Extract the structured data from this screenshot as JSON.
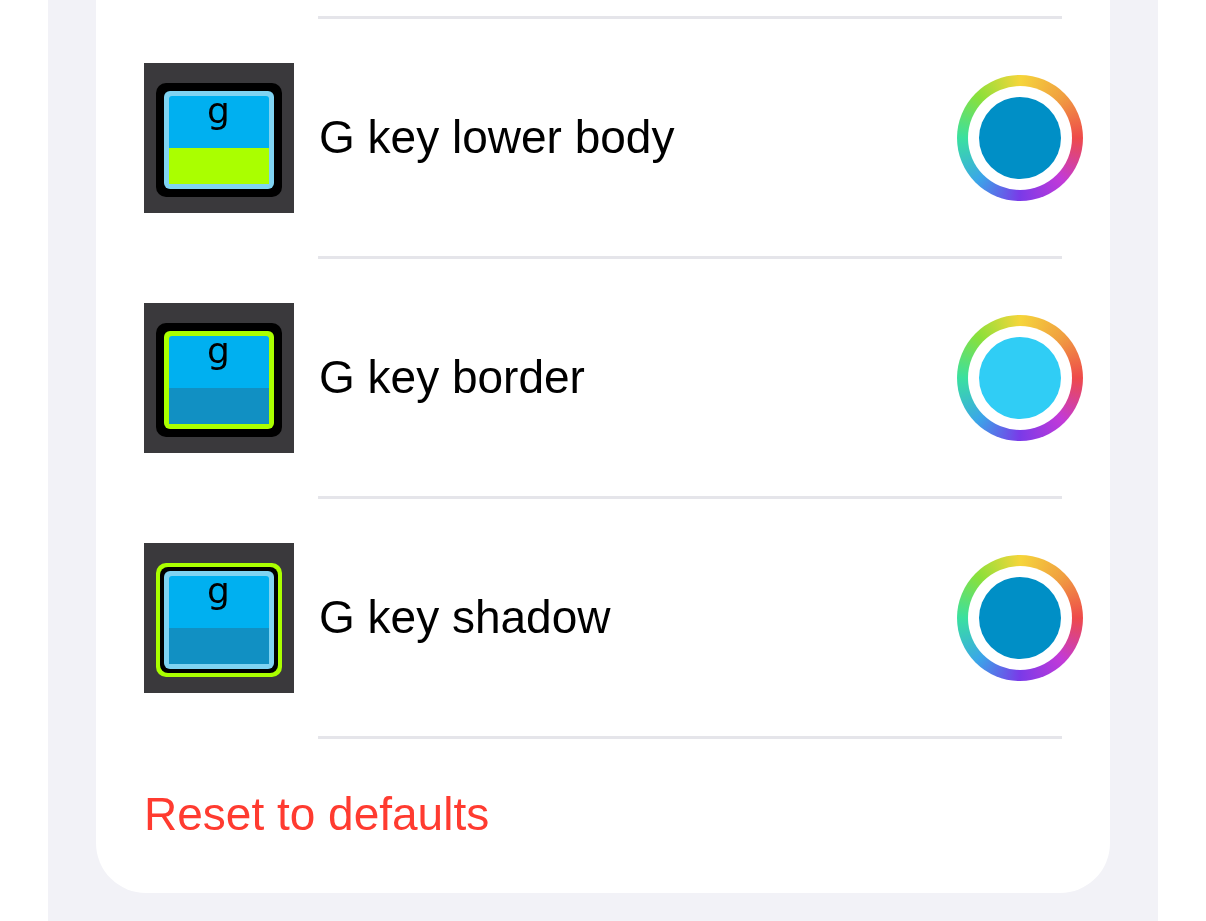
{
  "rows": [
    {
      "label": "G key lower body",
      "key_letter": "g",
      "kind": "lower_body",
      "color": "#008fc6"
    },
    {
      "label": "G key border",
      "key_letter": "g",
      "kind": "border",
      "color": "#30cdf5"
    },
    {
      "label": "G key shadow",
      "key_letter": "g",
      "kind": "shadow",
      "color": "#008fc6"
    }
  ],
  "reset_button": "Reset to defaults"
}
